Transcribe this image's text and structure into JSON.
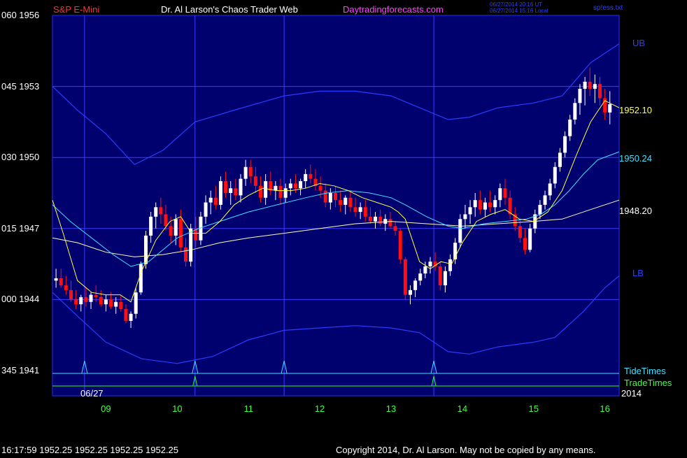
{
  "header": {
    "symbol": "S&P E-Mini",
    "title": "Dr. Al Larson's Chaos Trader Web",
    "site": "Daytradingforecasts.com",
    "timestamp_ut": "06/27/2014 20:16 UT",
    "timestamp_local": "06/27/2014 15:16 Local",
    "file": "sp!ess.txt"
  },
  "footer": {
    "quote": "16:17:59  1952.25 1952.25 1952.25 1952.25",
    "copyright": "Copyright 2014, Dr. Al Larson. May not be copied by any means."
  },
  "colors": {
    "background": "#000000",
    "plot_background": "#00006e",
    "grid": "#3c3cff",
    "up_candle": "#ffffff",
    "down_candle": "#ff1010",
    "band": "#2a3cff",
    "ma_fast": "#ffff40",
    "ma_mid": "#40e0ff",
    "ma_slow": "#ffffc0",
    "tide_times": "#40e0ff",
    "trade_times": "#20ff20"
  },
  "chart_data": {
    "type": "candlestick",
    "y_axis": {
      "range": [
        1941,
        1956
      ],
      "ticks": [
        {
          "left": "060",
          "right": "1956",
          "value": 1956
        },
        {
          "left": "045",
          "right": "1953",
          "value": 1953
        },
        {
          "left": "030",
          "right": "1950",
          "value": 1950
        },
        {
          "left": "015",
          "right": "1947",
          "value": 1947
        },
        {
          "left": "000",
          "right": "1944",
          "value": 1944
        },
        {
          "left": "345",
          "right": "1941",
          "value": 1941
        }
      ]
    },
    "x_axis": {
      "range": [
        8.25,
        16.2
      ],
      "ticks": [
        {
          "label": "09",
          "value": 9
        },
        {
          "label": "10",
          "value": 10
        },
        {
          "label": "11",
          "value": 11
        },
        {
          "label": "12",
          "value": 12
        },
        {
          "label": "13",
          "value": 13
        },
        {
          "label": "14",
          "value": 14
        },
        {
          "label": "15",
          "value": 15
        },
        {
          "label": "16",
          "value": 16
        }
      ],
      "date_label": "06/27",
      "year_label": "2014"
    },
    "vertical_markers": [
      8.7,
      10.25,
      11.5,
      13.6
    ],
    "price_labels": [
      {
        "text": "1952.10",
        "value": 1952.1
      },
      {
        "text": "1950.24",
        "value": 1950.24
      },
      {
        "text": "1948.20",
        "value": 1948.2
      }
    ],
    "band_labels": {
      "upper": "UB",
      "lower": "LB"
    },
    "legend": {
      "tide": "TideTimes",
      "trade": "TradeTimes"
    },
    "tide_times": [
      8.7,
      10.25,
      11.5,
      13.6
    ],
    "trade_times": [
      10.25,
      13.6
    ],
    "upper_band": [
      [
        8.25,
        1953.0
      ],
      [
        8.6,
        1952.0
      ],
      [
        9.0,
        1951.0
      ],
      [
        9.4,
        1949.7
      ],
      [
        9.8,
        1950.3
      ],
      [
        10.25,
        1951.5
      ],
      [
        10.8,
        1952.0
      ],
      [
        11.5,
        1952.6
      ],
      [
        12.0,
        1952.8
      ],
      [
        12.5,
        1952.8
      ],
      [
        13.0,
        1952.6
      ],
      [
        13.4,
        1952.1
      ],
      [
        13.8,
        1951.6
      ],
      [
        14.1,
        1951.7
      ],
      [
        14.5,
        1952.1
      ],
      [
        15.0,
        1952.3
      ],
      [
        15.4,
        1952.6
      ],
      [
        15.8,
        1954.0
      ],
      [
        16.2,
        1954.8
      ]
    ],
    "lower_band": [
      [
        8.25,
        1944.3
      ],
      [
        8.6,
        1943.3
      ],
      [
        9.0,
        1942.2
      ],
      [
        9.5,
        1941.5
      ],
      [
        10.0,
        1941.3
      ],
      [
        10.5,
        1941.6
      ],
      [
        11.0,
        1942.3
      ],
      [
        11.5,
        1942.7
      ],
      [
        12.0,
        1942.8
      ],
      [
        12.5,
        1942.9
      ],
      [
        13.0,
        1942.8
      ],
      [
        13.4,
        1942.6
      ],
      [
        13.8,
        1941.8
      ],
      [
        14.1,
        1941.7
      ],
      [
        14.5,
        1942.0
      ],
      [
        15.0,
        1942.2
      ],
      [
        15.3,
        1942.4
      ],
      [
        15.7,
        1943.5
      ],
      [
        16.0,
        1944.5
      ],
      [
        16.2,
        1945.0
      ]
    ],
    "ma_fast": [
      [
        8.25,
        1948.2
      ],
      [
        8.4,
        1946.8
      ],
      [
        8.6,
        1944.8
      ],
      [
        8.8,
        1944.3
      ],
      [
        9.0,
        1944.2
      ],
      [
        9.2,
        1944.2
      ],
      [
        9.35,
        1943.9
      ],
      [
        9.5,
        1945.2
      ],
      [
        9.7,
        1946.5
      ],
      [
        9.9,
        1947.3
      ],
      [
        10.05,
        1947.5
      ],
      [
        10.2,
        1946.8
      ],
      [
        10.4,
        1946.8
      ],
      [
        10.6,
        1947.3
      ],
      [
        10.8,
        1948.0
      ],
      [
        11.0,
        1948.4
      ],
      [
        11.2,
        1948.7
      ],
      [
        11.4,
        1948.6
      ],
      [
        11.6,
        1948.6
      ],
      [
        11.8,
        1948.7
      ],
      [
        12.0,
        1948.9
      ],
      [
        12.2,
        1948.8
      ],
      [
        12.4,
        1948.6
      ],
      [
        12.6,
        1948.3
      ],
      [
        12.8,
        1948.1
      ],
      [
        13.0,
        1947.9
      ],
      [
        13.1,
        1947.7
      ],
      [
        13.2,
        1947.4
      ],
      [
        13.3,
        1946.5
      ],
      [
        13.4,
        1945.6
      ],
      [
        13.55,
        1945.3
      ],
      [
        13.7,
        1945.6
      ],
      [
        13.85,
        1945.5
      ],
      [
        14.0,
        1946.4
      ],
      [
        14.2,
        1947.3
      ],
      [
        14.4,
        1947.6
      ],
      [
        14.6,
        1947.8
      ],
      [
        14.8,
        1947.4
      ],
      [
        15.0,
        1947.3
      ],
      [
        15.2,
        1947.7
      ],
      [
        15.4,
        1948.6
      ],
      [
        15.6,
        1950.1
      ],
      [
        15.8,
        1951.5
      ],
      [
        16.0,
        1952.4
      ],
      [
        16.2,
        1952.1
      ]
    ],
    "ma_mid": [
      [
        8.25,
        1948.0
      ],
      [
        8.5,
        1947.3
      ],
      [
        8.8,
        1946.6
      ],
      [
        9.1,
        1945.9
      ],
      [
        9.35,
        1945.4
      ],
      [
        9.6,
        1945.6
      ],
      [
        9.8,
        1946.1
      ],
      [
        10.0,
        1946.6
      ],
      [
        10.3,
        1947.0
      ],
      [
        10.6,
        1947.3
      ],
      [
        11.0,
        1947.7
      ],
      [
        11.4,
        1948.0
      ],
      [
        11.8,
        1948.3
      ],
      [
        12.1,
        1948.5
      ],
      [
        12.4,
        1948.6
      ],
      [
        12.7,
        1948.5
      ],
      [
        13.0,
        1948.3
      ],
      [
        13.2,
        1948.0
      ],
      [
        13.5,
        1947.5
      ],
      [
        13.8,
        1947.1
      ],
      [
        14.0,
        1947.0
      ],
      [
        14.3,
        1947.2
      ],
      [
        14.6,
        1947.3
      ],
      [
        14.9,
        1947.4
      ],
      [
        15.1,
        1947.6
      ],
      [
        15.3,
        1948.0
      ],
      [
        15.5,
        1948.6
      ],
      [
        15.7,
        1949.3
      ],
      [
        15.9,
        1949.9
      ],
      [
        16.2,
        1950.24
      ]
    ],
    "ma_slow": [
      [
        8.25,
        1946.6
      ],
      [
        8.6,
        1946.4
      ],
      [
        9.0,
        1946.0
      ],
      [
        9.4,
        1945.8
      ],
      [
        9.8,
        1945.9
      ],
      [
        10.2,
        1946.1
      ],
      [
        10.6,
        1946.4
      ],
      [
        11.0,
        1946.6
      ],
      [
        11.5,
        1946.8
      ],
      [
        12.0,
        1947.0
      ],
      [
        12.5,
        1947.2
      ],
      [
        13.0,
        1947.3
      ],
      [
        13.5,
        1947.2
      ],
      [
        14.0,
        1947.1
      ],
      [
        14.5,
        1947.2
      ],
      [
        15.0,
        1947.3
      ],
      [
        15.4,
        1947.4
      ],
      [
        15.8,
        1947.8
      ],
      [
        16.2,
        1948.2
      ]
    ],
    "candles": [
      [
        8.3,
        1944.8,
        1945.3,
        1944.5,
        1944.9
      ],
      [
        8.37,
        1944.9,
        1945.3,
        1944.5,
        1944.6
      ],
      [
        8.44,
        1944.6,
        1945.0,
        1944.2,
        1944.4
      ],
      [
        8.51,
        1944.4,
        1944.8,
        1943.9,
        1944.0
      ],
      [
        8.58,
        1944.0,
        1944.4,
        1943.6,
        1943.8
      ],
      [
        8.65,
        1943.8,
        1944.2,
        1943.5,
        1944.1
      ],
      [
        8.72,
        1944.1,
        1944.5,
        1943.7,
        1943.9
      ],
      [
        8.79,
        1943.9,
        1944.3,
        1943.6,
        1944.2
      ],
      [
        8.86,
        1944.2,
        1944.6,
        1943.9,
        1944.1
      ],
      [
        8.93,
        1944.1,
        1944.4,
        1943.7,
        1943.8
      ],
      [
        9.0,
        1943.8,
        1944.2,
        1943.5,
        1944.0
      ],
      [
        9.07,
        1944.0,
        1944.3,
        1943.6,
        1943.7
      ],
      [
        9.14,
        1943.7,
        1944.1,
        1943.4,
        1943.9
      ],
      [
        9.21,
        1943.9,
        1944.2,
        1943.5,
        1943.6
      ],
      [
        9.28,
        1943.6,
        1943.8,
        1943.0,
        1943.1
      ],
      [
        9.35,
        1943.1,
        1943.5,
        1942.8,
        1943.4
      ],
      [
        9.42,
        1943.4,
        1944.5,
        1943.2,
        1944.3
      ],
      [
        9.49,
        1944.3,
        1945.6,
        1944.2,
        1945.5
      ],
      [
        9.56,
        1945.5,
        1946.9,
        1945.3,
        1946.7
      ],
      [
        9.63,
        1946.7,
        1947.7,
        1946.4,
        1947.5
      ],
      [
        9.7,
        1947.5,
        1948.1,
        1947.0,
        1947.9
      ],
      [
        9.77,
        1947.9,
        1948.3,
        1947.2,
        1947.6
      ],
      [
        9.84,
        1947.6,
        1948.0,
        1946.9,
        1947.1
      ],
      [
        9.91,
        1947.1,
        1947.5,
        1946.4,
        1946.7
      ],
      [
        9.98,
        1946.7,
        1947.6,
        1946.3,
        1947.4
      ],
      [
        10.05,
        1947.4,
        1947.8,
        1946.0,
        1946.2
      ],
      [
        10.12,
        1946.2,
        1946.6,
        1945.4,
        1945.6
      ],
      [
        10.19,
        1945.6,
        1947.2,
        1945.4,
        1947.0
      ],
      [
        10.26,
        1947.0,
        1947.5,
        1946.2,
        1946.5
      ],
      [
        10.33,
        1946.5,
        1947.7,
        1946.3,
        1947.5
      ],
      [
        10.4,
        1947.5,
        1948.4,
        1947.2,
        1948.1
      ],
      [
        10.47,
        1948.1,
        1948.6,
        1947.6,
        1948.3
      ],
      [
        10.54,
        1948.3,
        1948.8,
        1947.8,
        1948.0
      ],
      [
        10.61,
        1948.0,
        1949.2,
        1947.8,
        1949.0
      ],
      [
        10.68,
        1949.0,
        1949.4,
        1948.3,
        1948.5
      ],
      [
        10.75,
        1948.5,
        1949.0,
        1948.0,
        1948.7
      ],
      [
        10.82,
        1948.7,
        1949.1,
        1948.2,
        1948.4
      ],
      [
        10.89,
        1948.4,
        1949.3,
        1948.1,
        1949.1
      ],
      [
        10.96,
        1949.1,
        1949.9,
        1948.8,
        1949.6
      ],
      [
        11.03,
        1949.6,
        1949.9,
        1948.9,
        1949.2
      ],
      [
        11.1,
        1949.2,
        1949.6,
        1948.5,
        1948.8
      ],
      [
        11.17,
        1948.8,
        1949.2,
        1948.1,
        1948.3
      ],
      [
        11.24,
        1948.3,
        1949.3,
        1948.0,
        1949.0
      ],
      [
        11.31,
        1949.0,
        1949.4,
        1948.4,
        1948.6
      ],
      [
        11.38,
        1948.6,
        1949.0,
        1948.2,
        1948.8
      ],
      [
        11.45,
        1948.8,
        1949.1,
        1948.0,
        1948.3
      ],
      [
        11.52,
        1948.3,
        1948.9,
        1948.1,
        1948.7
      ],
      [
        11.59,
        1948.7,
        1949.1,
        1948.4,
        1948.9
      ],
      [
        11.66,
        1948.9,
        1949.3,
        1948.5,
        1948.7
      ],
      [
        11.73,
        1948.7,
        1949.1,
        1948.4,
        1949.0
      ],
      [
        11.8,
        1949.0,
        1949.5,
        1948.7,
        1949.3
      ],
      [
        11.87,
        1949.3,
        1949.7,
        1948.9,
        1949.1
      ],
      [
        11.94,
        1949.1,
        1949.5,
        1948.6,
        1948.8
      ],
      [
        12.01,
        1948.8,
        1949.2,
        1948.3,
        1948.6
      ],
      [
        12.08,
        1948.6,
        1948.9,
        1947.9,
        1948.1
      ],
      [
        12.15,
        1948.1,
        1948.7,
        1947.8,
        1948.5
      ],
      [
        12.22,
        1948.5,
        1948.8,
        1947.9,
        1948.2
      ],
      [
        12.29,
        1948.2,
        1948.6,
        1947.7,
        1948.0
      ],
      [
        12.36,
        1948.0,
        1948.4,
        1947.6,
        1948.3
      ],
      [
        12.43,
        1948.3,
        1948.6,
        1947.7,
        1947.9
      ],
      [
        12.5,
        1947.9,
        1948.3,
        1947.5,
        1947.7
      ],
      [
        12.57,
        1947.7,
        1948.1,
        1947.4,
        1947.9
      ],
      [
        12.64,
        1947.9,
        1948.2,
        1947.3,
        1947.5
      ],
      [
        12.71,
        1947.5,
        1947.9,
        1947.2,
        1947.3
      ],
      [
        12.78,
        1947.3,
        1947.7,
        1947.0,
        1947.5
      ],
      [
        12.85,
        1947.5,
        1947.8,
        1947.1,
        1947.2
      ],
      [
        12.92,
        1947.2,
        1947.6,
        1946.9,
        1947.4
      ],
      [
        12.99,
        1947.4,
        1947.7,
        1947.0,
        1947.1
      ],
      [
        13.06,
        1947.1,
        1947.3,
        1946.7,
        1946.9
      ],
      [
        13.13,
        1946.9,
        1947.0,
        1945.5,
        1945.7
      ],
      [
        13.2,
        1945.7,
        1945.8,
        1944.0,
        1944.2
      ],
      [
        13.27,
        1944.2,
        1944.6,
        1943.8,
        1944.4
      ],
      [
        13.34,
        1944.4,
        1944.9,
        1944.1,
        1944.8
      ],
      [
        13.41,
        1944.8,
        1945.3,
        1944.6,
        1945.1
      ],
      [
        13.48,
        1945.1,
        1945.6,
        1944.9,
        1945.4
      ],
      [
        13.55,
        1945.4,
        1945.8,
        1945.1,
        1945.6
      ],
      [
        13.62,
        1945.6,
        1946.0,
        1945.2,
        1945.4
      ],
      [
        13.69,
        1945.4,
        1945.6,
        1944.4,
        1944.6
      ],
      [
        13.76,
        1944.6,
        1945.4,
        1944.3,
        1945.2
      ],
      [
        13.83,
        1945.2,
        1945.9,
        1945.0,
        1945.7
      ],
      [
        13.9,
        1945.7,
        1946.6,
        1945.5,
        1946.4
      ],
      [
        13.97,
        1946.4,
        1947.6,
        1946.2,
        1947.4
      ],
      [
        14.04,
        1947.4,
        1948.0,
        1947.0,
        1947.6
      ],
      [
        14.11,
        1947.6,
        1948.2,
        1947.2,
        1947.9
      ],
      [
        14.18,
        1947.9,
        1948.5,
        1947.5,
        1948.2
      ],
      [
        14.25,
        1948.2,
        1948.6,
        1947.6,
        1947.8
      ],
      [
        14.32,
        1947.8,
        1948.3,
        1947.5,
        1948.1
      ],
      [
        14.39,
        1948.1,
        1948.6,
        1947.7,
        1947.9
      ],
      [
        14.46,
        1947.9,
        1948.4,
        1947.6,
        1948.2
      ],
      [
        14.53,
        1948.2,
        1948.9,
        1947.9,
        1948.7
      ],
      [
        14.6,
        1948.7,
        1949.1,
        1948.0,
        1948.3
      ],
      [
        14.67,
        1948.3,
        1948.6,
        1947.4,
        1947.6
      ],
      [
        14.74,
        1947.6,
        1947.9,
        1946.9,
        1947.1
      ],
      [
        14.81,
        1947.1,
        1947.4,
        1946.4,
        1946.6
      ],
      [
        14.88,
        1946.6,
        1947.0,
        1945.9,
        1946.1
      ],
      [
        14.95,
        1946.1,
        1947.2,
        1946.0,
        1947.0
      ],
      [
        15.02,
        1947.0,
        1947.8,
        1946.8,
        1947.6
      ],
      [
        15.09,
        1947.6,
        1948.2,
        1947.4,
        1948.0
      ],
      [
        15.16,
        1948.0,
        1948.6,
        1947.8,
        1948.4
      ],
      [
        15.23,
        1948.4,
        1949.1,
        1948.2,
        1948.9
      ],
      [
        15.3,
        1948.9,
        1949.8,
        1948.7,
        1949.6
      ],
      [
        15.37,
        1949.6,
        1950.4,
        1949.4,
        1950.2
      ],
      [
        15.44,
        1950.2,
        1951.1,
        1950.0,
        1950.9
      ],
      [
        15.51,
        1950.9,
        1951.8,
        1950.7,
        1951.6
      ],
      [
        15.58,
        1951.6,
        1952.5,
        1951.4,
        1952.3
      ],
      [
        15.65,
        1952.3,
        1953.1,
        1951.8,
        1952.9
      ],
      [
        15.72,
        1952.9,
        1953.4,
        1952.2,
        1953.2
      ],
      [
        15.79,
        1953.2,
        1953.8,
        1952.6,
        1952.9
      ],
      [
        15.86,
        1952.9,
        1953.5,
        1952.3,
        1953.1
      ],
      [
        15.93,
        1953.1,
        1953.4,
        1952.2,
        1952.5
      ],
      [
        16.0,
        1952.5,
        1952.9,
        1951.6,
        1951.9
      ],
      [
        16.07,
        1951.9,
        1952.8,
        1951.4,
        1952.25
      ]
    ]
  }
}
